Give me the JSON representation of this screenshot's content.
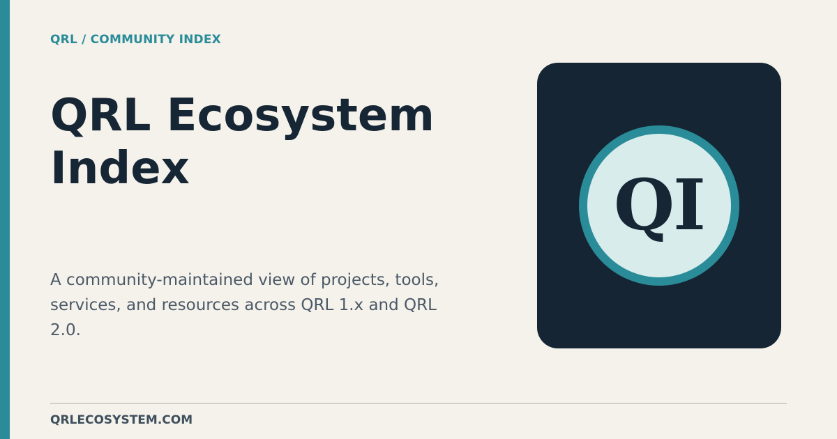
{
  "header": {
    "breadcrumb": "QRL / COMMUNITY INDEX"
  },
  "main": {
    "title": "QRL Ecosystem Index",
    "description": "A community-maintained view of projects, tools, services, and resources across QRL 1.x and QRL 2.0."
  },
  "logo": {
    "mark": "QI"
  },
  "footer": {
    "url": "QRLECOSYSTEM.COM"
  },
  "colors": {
    "accent": "#2a8c98",
    "background": "#f5f2ec",
    "ink": "#172634",
    "card": "#152533",
    "logo_fill": "#d8ecec"
  }
}
